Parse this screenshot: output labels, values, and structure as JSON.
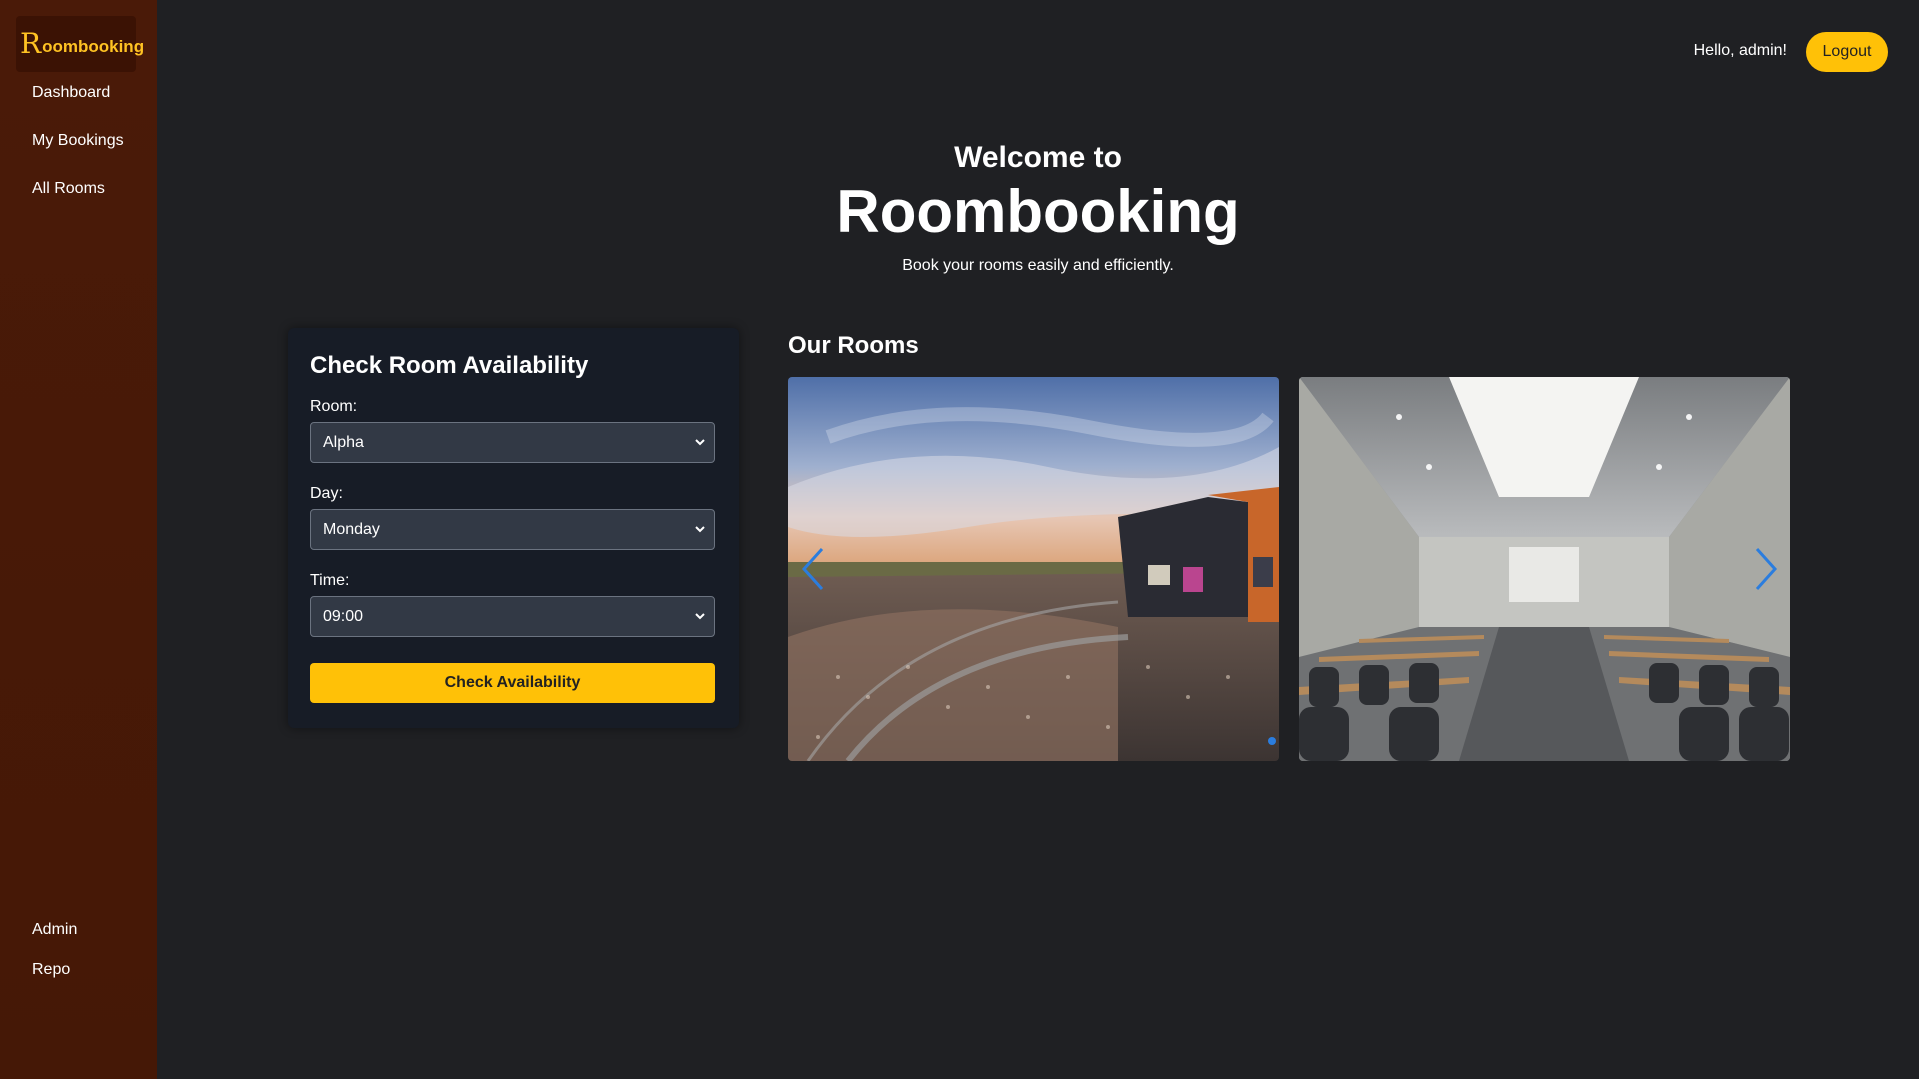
{
  "brand": {
    "initial": "R",
    "rest": "oombooking"
  },
  "sidebar": {
    "items": [
      {
        "label": "Dashboard"
      },
      {
        "label": "My Bookings"
      },
      {
        "label": "All Rooms"
      }
    ],
    "bottom_items": [
      {
        "label": "Admin"
      },
      {
        "label": "Repo"
      }
    ]
  },
  "header": {
    "greeting": "Hello, admin!",
    "logout_label": "Logout"
  },
  "hero": {
    "welcome": "Welcome to",
    "title": "Roombooking",
    "subtitle": "Book your rooms easily and efficiently."
  },
  "availability": {
    "title": "Check Room Availability",
    "room_label": "Room:",
    "room_value": "Alpha",
    "day_label": "Day:",
    "day_value": "Monday",
    "time_label": "Time:",
    "time_value": "09:00",
    "button_label": "Check Availability"
  },
  "rooms": {
    "title": "Our Rooms",
    "slides": [
      {
        "name": "amphitheater-image"
      },
      {
        "name": "conference-room-image"
      }
    ]
  },
  "colors": {
    "accent": "#ffc107",
    "sidebar": "#4a1a08",
    "background": "#1f2023",
    "card": "#171c26",
    "carousel_control": "#2b7dde"
  },
  "icons": {
    "prev": "chevron-left-icon",
    "next": "chevron-right-icon",
    "select": "chevron-down-icon"
  }
}
